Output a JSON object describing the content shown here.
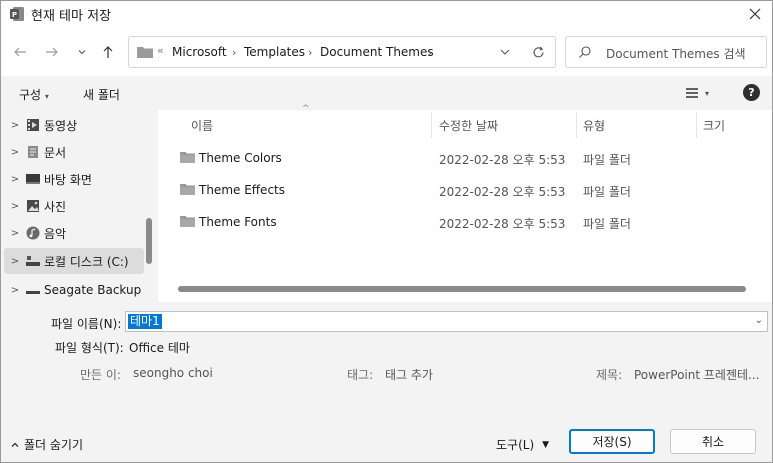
{
  "window": {
    "title": "현재 테마 저장"
  },
  "address": {
    "overflow": "«",
    "breadcrumbs": [
      "Microsoft",
      "Templates",
      "Document Themes"
    ]
  },
  "search": {
    "placeholder": "Document Themes 검색"
  },
  "toolbar": {
    "organize": "구성",
    "new_folder": "새 폴더"
  },
  "nav": {
    "items": [
      {
        "label": "동영상",
        "icon": "video-icon"
      },
      {
        "label": "문서",
        "icon": "document-icon"
      },
      {
        "label": "바탕 화면",
        "icon": "desktop-icon"
      },
      {
        "label": "사진",
        "icon": "pictures-icon"
      },
      {
        "label": "음악",
        "icon": "music-icon"
      },
      {
        "label": "로컬 디스크 (C:)",
        "icon": "drive-icon",
        "selected": true
      },
      {
        "label": "Seagate Backup",
        "icon": "drive-icon"
      }
    ]
  },
  "list": {
    "columns": {
      "name": "이름",
      "modified": "수정한 날짜",
      "type": "유형",
      "size": "크기"
    },
    "rows": [
      {
        "name": "Theme Colors",
        "modified": "2022-02-28 오후 5:53",
        "type": "파일 폴더"
      },
      {
        "name": "Theme Effects",
        "modified": "2022-02-28 오후 5:53",
        "type": "파일 폴더"
      },
      {
        "name": "Theme Fonts",
        "modified": "2022-02-28 오후 5:53",
        "type": "파일 폴더"
      }
    ]
  },
  "form": {
    "filename_label": "파일 이름(N):",
    "filename_value": "테마1",
    "filetype_label": "파일 형식(T):",
    "filetype_value": "Office 테마",
    "author_label": "만든 이:",
    "author_value": "seongho choi",
    "tags_label": "태그:",
    "tags_value": "태그 추가",
    "title_label": "제목:",
    "title_value": "PowerPoint 프레젠테..."
  },
  "footer": {
    "hide_folders": "폴더 숨기기",
    "tools": "도구(L)",
    "save": "저장(S)",
    "cancel": "취소"
  },
  "colors": {
    "accent": "#0078d4",
    "pane": "#f3f3f3",
    "folder": "#9a9a9a"
  }
}
